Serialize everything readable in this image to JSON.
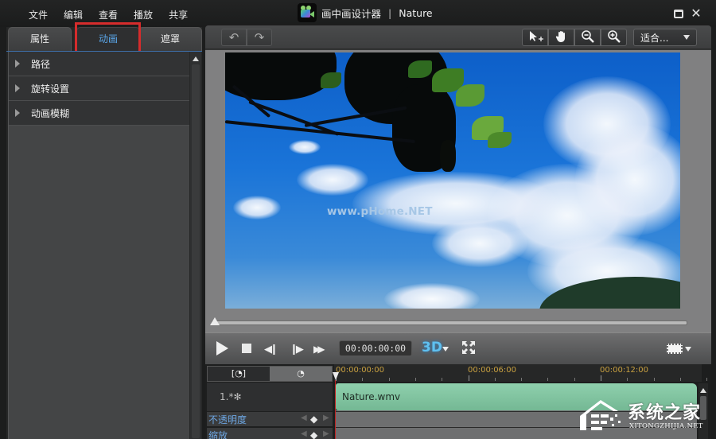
{
  "titlebar": {
    "menu": [
      "文件",
      "编辑",
      "查看",
      "播放",
      "共享"
    ],
    "app_name": "画中画设计器",
    "separator": "|",
    "document": "Nature",
    "logo_icon": "video-camera-icon",
    "maximize_icon": "maximize-icon",
    "close_icon": "close-icon"
  },
  "left_panel": {
    "tabs": [
      {
        "label": "属性",
        "active": false
      },
      {
        "label": "动画",
        "active": true
      },
      {
        "label": "遮罩",
        "active": false
      }
    ],
    "sections": [
      {
        "label": "路径",
        "expanded": false
      },
      {
        "label": "旋转设置",
        "expanded": false
      },
      {
        "label": "动画模糊",
        "expanded": false
      }
    ],
    "annotation_color": "#d52c2c"
  },
  "preview_toolbar": {
    "undo_icon": "undo-icon",
    "redo_icon": "redo-icon",
    "tools": [
      {
        "name": "select-move-tool",
        "glyph": "⮞"
      },
      {
        "name": "hand-pan-tool",
        "glyph": "✋"
      },
      {
        "name": "zoom-out-tool",
        "glyph": "⊖"
      },
      {
        "name": "zoom-in-tool",
        "glyph": "⊕"
      }
    ],
    "fit_select": {
      "value": "适合..."
    }
  },
  "preview": {
    "overlay_watermark": "www.pHome.NET",
    "scrubber_position": 0
  },
  "playback": {
    "timecode": "00:00:00:00",
    "btn_3d": "3D",
    "play_glyph": "▶",
    "prev_frame_glyph": "◀❙",
    "next_frame_glyph": "❙▶",
    "fast_forward_glyph": "▶▶"
  },
  "timeline": {
    "header_buttons": [
      "[◔]",
      "◔"
    ],
    "ruler_labels": [
      "00:00:00:00",
      "00:00:06:00",
      "00:00:12:00"
    ],
    "track": {
      "label": "1.*✻",
      "clip": "Nature.wmv",
      "clip_color": "#80c4a0"
    },
    "properties": [
      {
        "label": "不透明度"
      },
      {
        "label": "缩放"
      }
    ],
    "keyframe_prev": "◀",
    "keyframe_add": "◆",
    "keyframe_next": "▶"
  },
  "site_watermark": {
    "name": "系统之家",
    "domain": "XITONGZHIJIA.NET"
  }
}
